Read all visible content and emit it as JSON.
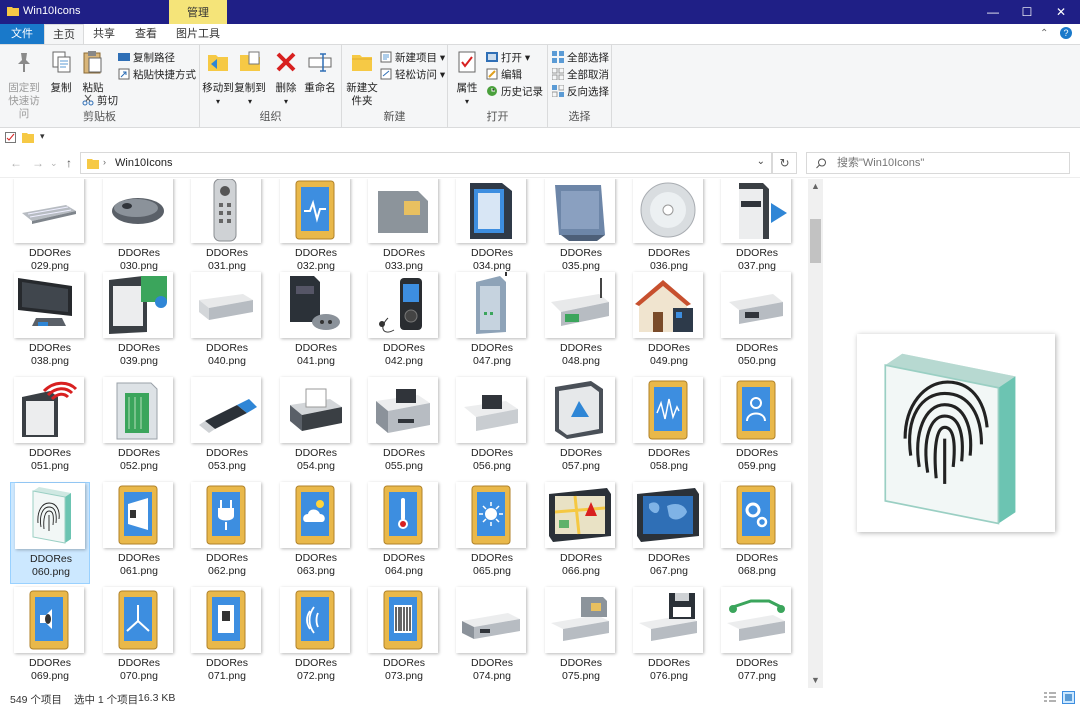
{
  "window": {
    "title": "Win10Icons",
    "context_tab": "管理"
  },
  "ribbon_tabs": [
    "文件",
    "主页",
    "共享",
    "查看",
    "图片工具"
  ],
  "ribbon": {
    "clipboard": {
      "pin": "固定到快速访问",
      "copy": "复制",
      "paste": "粘贴",
      "copy_path": "复制路径",
      "paste_shortcut": "粘贴快捷方式",
      "cut": "剪切",
      "label": "剪贴板"
    },
    "organize": {
      "move_to": "移动到",
      "copy_to": "复制到",
      "delete": "删除",
      "rename": "重命名",
      "label": "组织"
    },
    "new": {
      "new_folder": "新建文件夹",
      "new_item": "新建项目",
      "easy_access": "轻松访问",
      "label": "新建"
    },
    "open": {
      "properties": "属性",
      "open": "打开",
      "edit": "编辑",
      "history": "历史记录",
      "label": "打开"
    },
    "select": {
      "select_all": "全部选择",
      "select_none": "全部取消",
      "invert": "反向选择",
      "label": "选择"
    }
  },
  "address": {
    "breadcrumb": "Win10Icons",
    "search_placeholder": "搜索\"Win10Icons\""
  },
  "files": [
    {
      "name": "DDORes 029.png",
      "icon": "keyboard"
    },
    {
      "name": "DDORes 030.png",
      "icon": "mouse"
    },
    {
      "name": "DDORes 031.png",
      "icon": "remote"
    },
    {
      "name": "DDORes 032.png",
      "icon": "device-health"
    },
    {
      "name": "DDORes 033.png",
      "icon": "sim-card"
    },
    {
      "name": "DDORes 034.png",
      "icon": "pda"
    },
    {
      "name": "DDORes 035.png",
      "icon": "expansion-card"
    },
    {
      "name": "DDORes 036.png",
      "icon": "cd-disc"
    },
    {
      "name": "DDORes 037.png",
      "icon": "media-server"
    },
    {
      "name": "DDORes 038.png",
      "icon": "monitor"
    },
    {
      "name": "DDORes 039.png",
      "icon": "media-center"
    },
    {
      "name": "DDORes 040.png",
      "icon": "set-top-box"
    },
    {
      "name": "DDORes 041.png",
      "icon": "game-console"
    },
    {
      "name": "DDORes 042.png",
      "icon": "mp3-player"
    },
    {
      "name": "DDORes 047.png",
      "icon": "router"
    },
    {
      "name": "DDORes 048.png",
      "icon": "wireless-ap"
    },
    {
      "name": "DDORes 049.png",
      "icon": "home-network"
    },
    {
      "name": "DDORes 050.png",
      "icon": "network-drive"
    },
    {
      "name": "DDORes 051.png",
      "icon": "wifi-server"
    },
    {
      "name": "DDORes 052.png",
      "icon": "memory-card"
    },
    {
      "name": "DDORes 053.png",
      "icon": "usb-drive"
    },
    {
      "name": "DDORes 054.png",
      "icon": "fax"
    },
    {
      "name": "DDORes 055.png",
      "icon": "printer"
    },
    {
      "name": "DDORes 056.png",
      "icon": "printer-small"
    },
    {
      "name": "DDORes 057.png",
      "icon": "3d-printer"
    },
    {
      "name": "DDORes 058.png",
      "icon": "device-waveform"
    },
    {
      "name": "DDORes 059.png",
      "icon": "device-person"
    },
    {
      "name": "DDORes 060.png",
      "icon": "fingerprint",
      "selected": true
    },
    {
      "name": "DDORes 061.png",
      "icon": "device-scanner"
    },
    {
      "name": "DDORes 062.png",
      "icon": "device-plug"
    },
    {
      "name": "DDORes 063.png",
      "icon": "device-weather"
    },
    {
      "name": "DDORes 064.png",
      "icon": "device-thermometer"
    },
    {
      "name": "DDORes 065.png",
      "icon": "device-sun"
    },
    {
      "name": "DDORes 066.png",
      "icon": "gps-map"
    },
    {
      "name": "DDORes 067.png",
      "icon": "gps-world"
    },
    {
      "name": "DDORes 068.png",
      "icon": "device-gears"
    },
    {
      "name": "DDORes 069.png",
      "icon": "device-speaker"
    },
    {
      "name": "DDORes 070.png",
      "icon": "device-compass"
    },
    {
      "name": "DDORes 071.png",
      "icon": "device-nfc"
    },
    {
      "name": "DDORes 072.png",
      "icon": "device-signal"
    },
    {
      "name": "DDORes 073.png",
      "icon": "device-barcode"
    },
    {
      "name": "DDORes 074.png",
      "icon": "drive"
    },
    {
      "name": "DDORes 075.png",
      "icon": "drive-sim"
    },
    {
      "name": "DDORes 076.png",
      "icon": "drive-floppy"
    },
    {
      "name": "DDORes 077.png",
      "icon": "drive-network"
    }
  ],
  "status": {
    "count": "549 个项目",
    "selection": "选中 1 个项目",
    "size": "16.3 KB"
  },
  "colors": {
    "titlebar": "#1f1f86",
    "file_tab": "#1979ca",
    "context_tab": "#f5e479",
    "selection": "#cce8ff"
  }
}
